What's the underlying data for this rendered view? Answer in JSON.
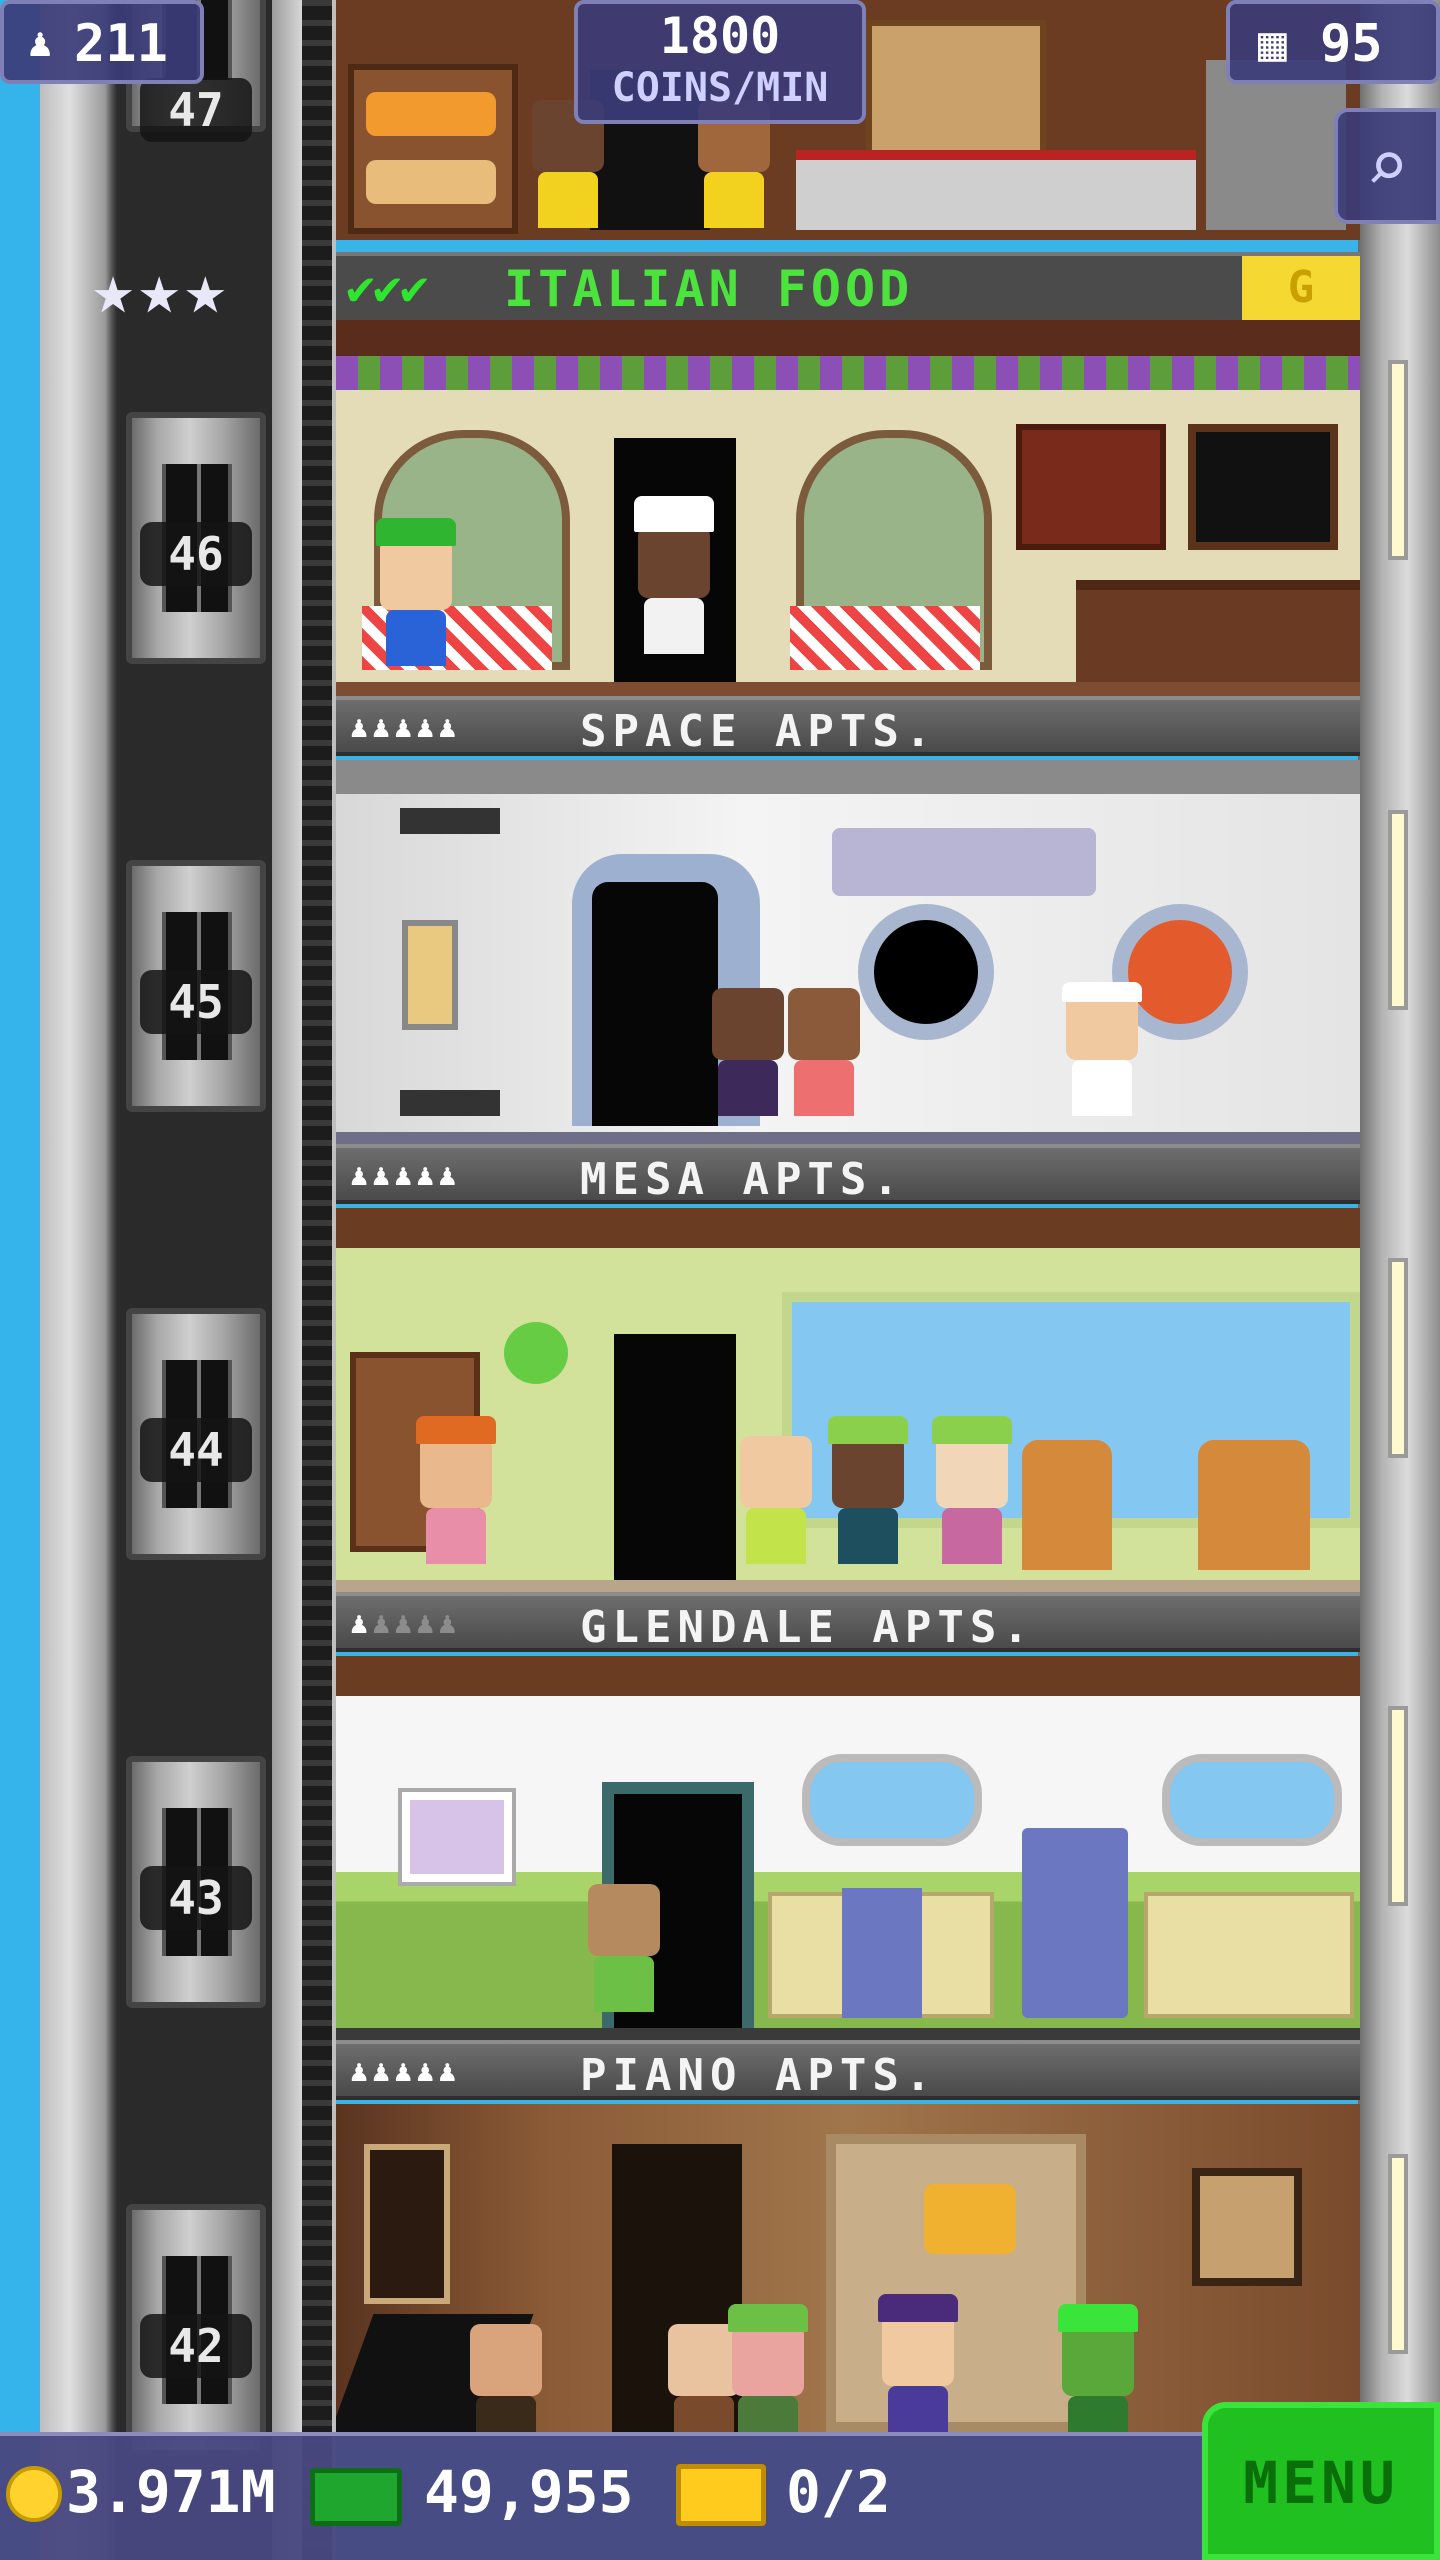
{
  "hud": {
    "population": "211",
    "rate_value": "1800",
    "rate_unit": "COINS/MIN",
    "floors": "95",
    "people_icon": "person-icon",
    "floors_icon": "building-icon",
    "zoom_icon": "magnifier-icon"
  },
  "top_floor": {
    "number": "47",
    "stars": "★★★",
    "checks": "✔✔✔",
    "name": "ITALIAN FOOD",
    "badge": "G"
  },
  "floors": [
    {
      "number": "46",
      "banner_title": "SPACE APTS.",
      "residents": 5
    },
    {
      "number": "45",
      "banner_title": "MESA APTS.",
      "residents": 5
    },
    {
      "number": "44",
      "banner_title": "GLENDALE APTS.",
      "residents": 1
    },
    {
      "number": "43",
      "banner_title": "PIANO APTS.",
      "residents": 5
    },
    {
      "number": "42"
    }
  ],
  "bottom": {
    "coins": "3.971M",
    "bux": "49,955",
    "tickets": "0/2",
    "menu": "MENU"
  },
  "colors": {
    "sky": "#34b4ea",
    "food_name": "#4ae43c",
    "menu_button": "#1fc01f",
    "coin": "#ffd22e",
    "bux": "#1ea62e",
    "ticket": "#ffcc1e"
  }
}
